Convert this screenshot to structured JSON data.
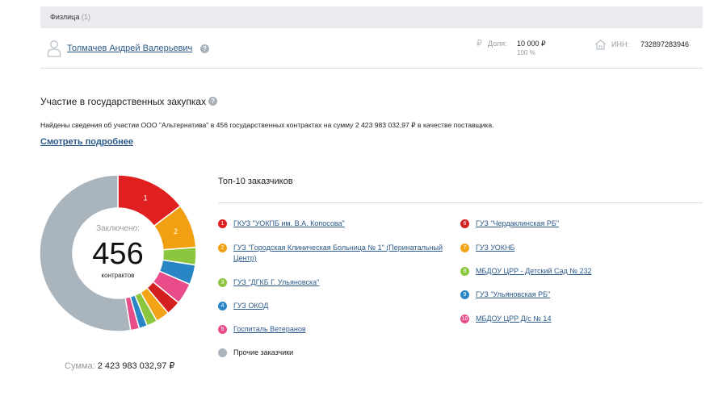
{
  "founders": {
    "title": "Физлица",
    "count": "(1)"
  },
  "person": {
    "name": "Толмачев Андрей Валерьевич",
    "share_label": "Доля:",
    "share_value": "10 000 ₽",
    "share_percent": "100 %",
    "inn_label": "ИНН:",
    "inn_value": "732897283946"
  },
  "procurement": {
    "title": "Участие в государственных закупках",
    "info": "Найдены сведения об участии ООО \"Альтернатива\" в 456 государственных контрактах на сумму 2 423 983 032,97 ₽ в качестве поставщика.",
    "more_link": "Смотреть подробнее",
    "donut_label": "Заключено:",
    "donut_count": "456",
    "donut_unit": "контрактов",
    "sum_label": "Сумма:",
    "sum_value": "2 423 983 032,97 ₽"
  },
  "top": {
    "title": "Топ-10 заказчиков",
    "customers": [
      {
        "num": "1",
        "name": "ГКУЗ \"УОКПБ им. В.А. Копосова\"",
        "color": "#e02020"
      },
      {
        "num": "2",
        "name": "ГУЗ \"Городская Клиническая Больница № 1\" (Перинатальный Центр)",
        "color": "#f0a010"
      },
      {
        "num": "3",
        "name": "ГУЗ \"ДГКБ Г. Ульяновска\"",
        "color": "#8cc63f"
      },
      {
        "num": "4",
        "name": "ГУЗ ОКОД",
        "color": "#2a85c5"
      },
      {
        "num": "5",
        "name": "Госпиталь Ветеранов",
        "color": "#e84d8a"
      },
      {
        "num": "6",
        "name": "ГУЗ \"Чердаклинская РБ\"",
        "color": "#d32121"
      },
      {
        "num": "7",
        "name": "ГУЗ УОКНБ",
        "color": "#f3a416"
      },
      {
        "num": "8",
        "name": "МБДОУ ЦРР - Детский Сад № 232",
        "color": "#8cc63f"
      },
      {
        "num": "9",
        "name": "ГУЗ \"Ульяновская РБ\"",
        "color": "#2a85c5"
      },
      {
        "num": "10",
        "name": "МБДОУ ЦРР Д/с № 14",
        "color": "#e84d8a"
      }
    ],
    "other": {
      "name": "Прочие заказчики",
      "color": "#aab4bd"
    }
  },
  "chart_data": {
    "type": "pie",
    "title": "",
    "categories": [
      "1",
      "2",
      "3",
      "4",
      "5",
      "6",
      "7",
      "8",
      "9",
      "10",
      "Прочие заказчики"
    ],
    "values": [
      14.7,
      9.1,
      3.6,
      4.1,
      4.4,
      3.0,
      2.8,
      2.2,
      1.7,
      1.8,
      52.6
    ],
    "colors": [
      "#e02020",
      "#f0a010",
      "#8cc63f",
      "#2a85c5",
      "#e84d8a",
      "#d32121",
      "#f3a416",
      "#8cc63f",
      "#2a85c5",
      "#e84d8a",
      "#aab4bd"
    ],
    "slice_labels": [
      "1",
      "2",
      "",
      "",
      "",
      "",
      "",
      "",
      "",
      "",
      ""
    ]
  }
}
